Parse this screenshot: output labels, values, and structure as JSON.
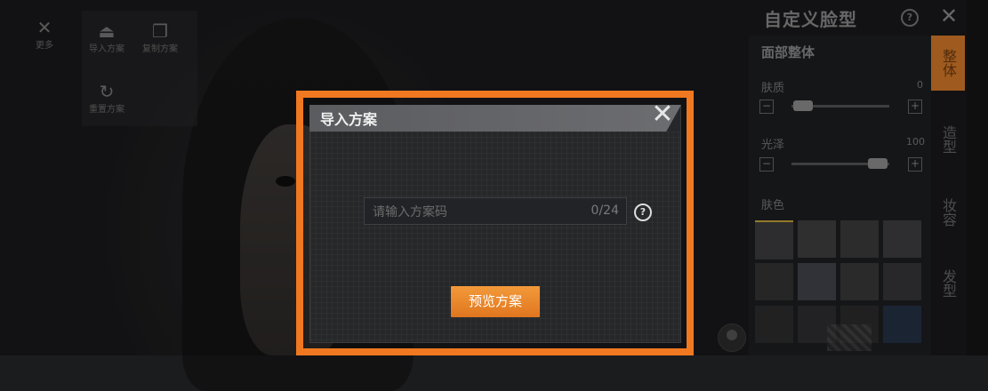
{
  "toolbar": {
    "close_label": "更多",
    "import_label": "导入方案",
    "copy_label": "复制方案",
    "reset_label": "重置方案"
  },
  "panel": {
    "title": "自定义脸型",
    "section": "面部整体",
    "sliders": [
      {
        "label": "肤质",
        "value": "0"
      },
      {
        "label": "光泽",
        "value": "100"
      }
    ],
    "skin_label": "肤色",
    "swatch_colors": [
      "#3d3d3f",
      "#3f3f41",
      "#3b3b3d",
      "#3e3e40",
      "#333335",
      "#41434a",
      "#38383a",
      "#363638",
      "#2c2c2e",
      "#2e2e30",
      "#2b2b2d",
      "#243044"
    ]
  },
  "tabs": [
    "整体",
    "造型",
    "妆容",
    "发型"
  ],
  "dialog": {
    "title": "导入方案",
    "input_placeholder": "请输入方案码",
    "counter": "0/24",
    "preview_button": "预览方案"
  },
  "colors": {
    "accent": "#f07820",
    "button": "#e0761f",
    "tab_active": "#d47a2a"
  }
}
